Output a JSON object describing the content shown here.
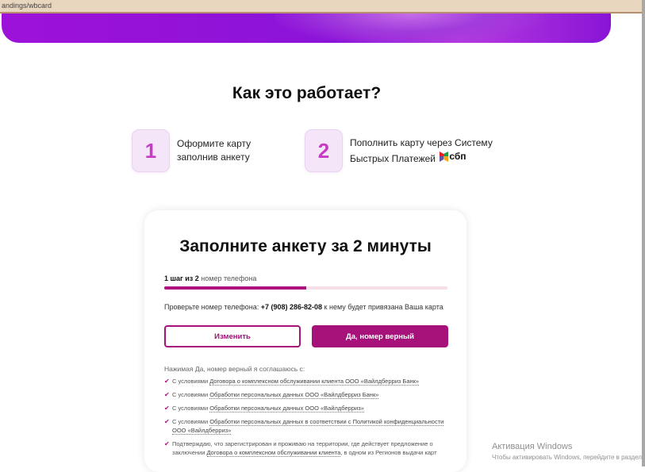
{
  "browser": {
    "url": "andings/wbcard"
  },
  "how": {
    "title": "Как это работает?",
    "steps": [
      {
        "number": "1",
        "line1": "Оформите карту",
        "line2": "заполнив анкету"
      },
      {
        "number": "2",
        "line1": "Пополнить карту через Систему",
        "line2": "Быстрых Платежей",
        "logo_text": "сбп"
      }
    ]
  },
  "form": {
    "title": "Заполните анкету за 2 минуты",
    "step_label_bold": "1 шаг из 2",
    "step_label_rest": " номер телефона",
    "progress": 0.5,
    "phone_prefix": "Проверьте номер телефона: ",
    "phone_number": "+7 (908) 286-82-08",
    "phone_suffix": " к нему будет привязана Ваша карта",
    "change_button": "Изменить",
    "confirm_button": "Да, номер верный",
    "agree_intro": "Нажимая Да, номер верный я соглашаюсь с:",
    "agreements": [
      {
        "pre": "С условиями ",
        "link": "Договора о комплексном обслуживании клиента ООО «Вайлдберриз Банк»",
        "post": ""
      },
      {
        "pre": "С условиями ",
        "link": "Обработки персональных данных ООО «Вайлдберриз Банк»",
        "post": ""
      },
      {
        "pre": "С условиями ",
        "link": "Обработки персональных данных ООО «Вайлдберриз»",
        "post": ""
      },
      {
        "pre": "С условиями ",
        "link": "Обработки персональных данных в соответствии с Политикой конфиденциальности ООО «Вайлдберриз»",
        "post": ""
      },
      {
        "pre": "Подтверждаю, что зарегистрирован и проживаю на территории, где действует предложение о заключении ",
        "link": "Договора о комплексном обслуживании клиента",
        "post": ", в одном из Регионов выдачи карт"
      }
    ]
  },
  "windows_watermark": {
    "title": "Активация Windows",
    "subtitle": "Чтобы активировать Windows, перейдите в раздел"
  },
  "colors": {
    "brand_primary": "#a6127a",
    "hero_purple": "#9d12d8",
    "step_number": "#c73cc4"
  }
}
